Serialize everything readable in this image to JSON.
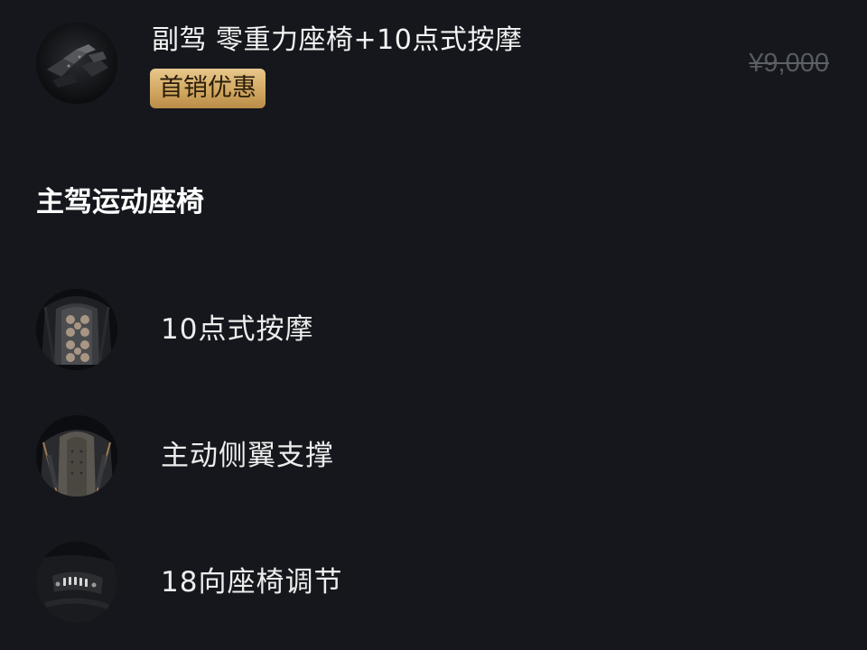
{
  "option": {
    "title": "副驾 零重力座椅+10点式按摩",
    "badge": "首销优惠",
    "original_price": "¥9,000",
    "image_icon": "passenger-zero-gravity-seat"
  },
  "section": {
    "title": "主驾运动座椅",
    "features": [
      {
        "label": "10点式按摩",
        "icon": "seat-massage-points"
      },
      {
        "label": "主动侧翼支撑",
        "icon": "seat-side-bolster"
      },
      {
        "label": "18向座椅调节",
        "icon": "seat-adjust-controls"
      }
    ]
  },
  "colors": {
    "background": "#15171c",
    "badge_gold": "#d2a862",
    "price_muted": "#565a62"
  }
}
